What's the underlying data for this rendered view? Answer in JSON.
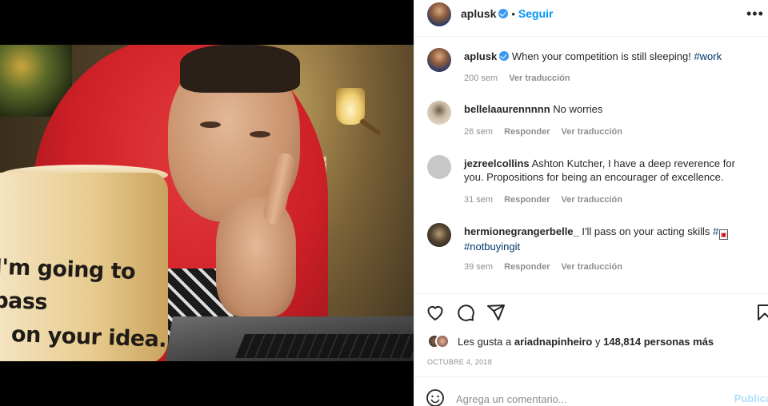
{
  "post": {
    "mug_line1": "I'm going to pass",
    "mug_line2": "on your idea."
  },
  "header": {
    "username": "aplusk",
    "dot": "•",
    "follow_label": "Seguir",
    "more_label": "•••"
  },
  "caption": {
    "username": "aplusk",
    "text": "When your competition is still sleeping!",
    "hashtag": "#work",
    "time": "200 sem",
    "translate": "Ver traducción"
  },
  "comments": [
    {
      "username": "bellelaaurennnnn",
      "text": "No worries",
      "time": "26 sem",
      "reply": "Responder",
      "translate": "Ver traducción"
    },
    {
      "username": "jezreelcollins",
      "text": "Ashton Kutcher, I have a deep reverence for you. Propositions for being an encourager of excellence.",
      "time": "31 sem",
      "reply": "Responder",
      "translate": "Ver traducción"
    },
    {
      "username": "hermionegrangerbelle_",
      "text": "I'll pass on your acting skills",
      "hashtag1": "#",
      "hashtag2": "#notbuyingit",
      "time": "39 sem",
      "reply": "Responder",
      "translate": "Ver traducción"
    }
  ],
  "likes": {
    "prefix": "Les gusta a",
    "user": "ariadnapinheiro",
    "conj": "y",
    "count_text": "148,814 personas más"
  },
  "date": "OCTUBRE 4, 2018",
  "comment_box": {
    "placeholder": "Agrega un comentario...",
    "publish_label": "Publicar"
  },
  "icons": {
    "like": "heart-icon",
    "comment": "comment-icon",
    "share": "share-icon",
    "save": "bookmark-icon",
    "emoji": "emoji-icon"
  },
  "colors": {
    "accent": "#0095f6",
    "verified": "#3897f0",
    "hashtag": "#00376b",
    "muted": "#8e8e8e",
    "publish_disabled": "#b2dffc"
  }
}
